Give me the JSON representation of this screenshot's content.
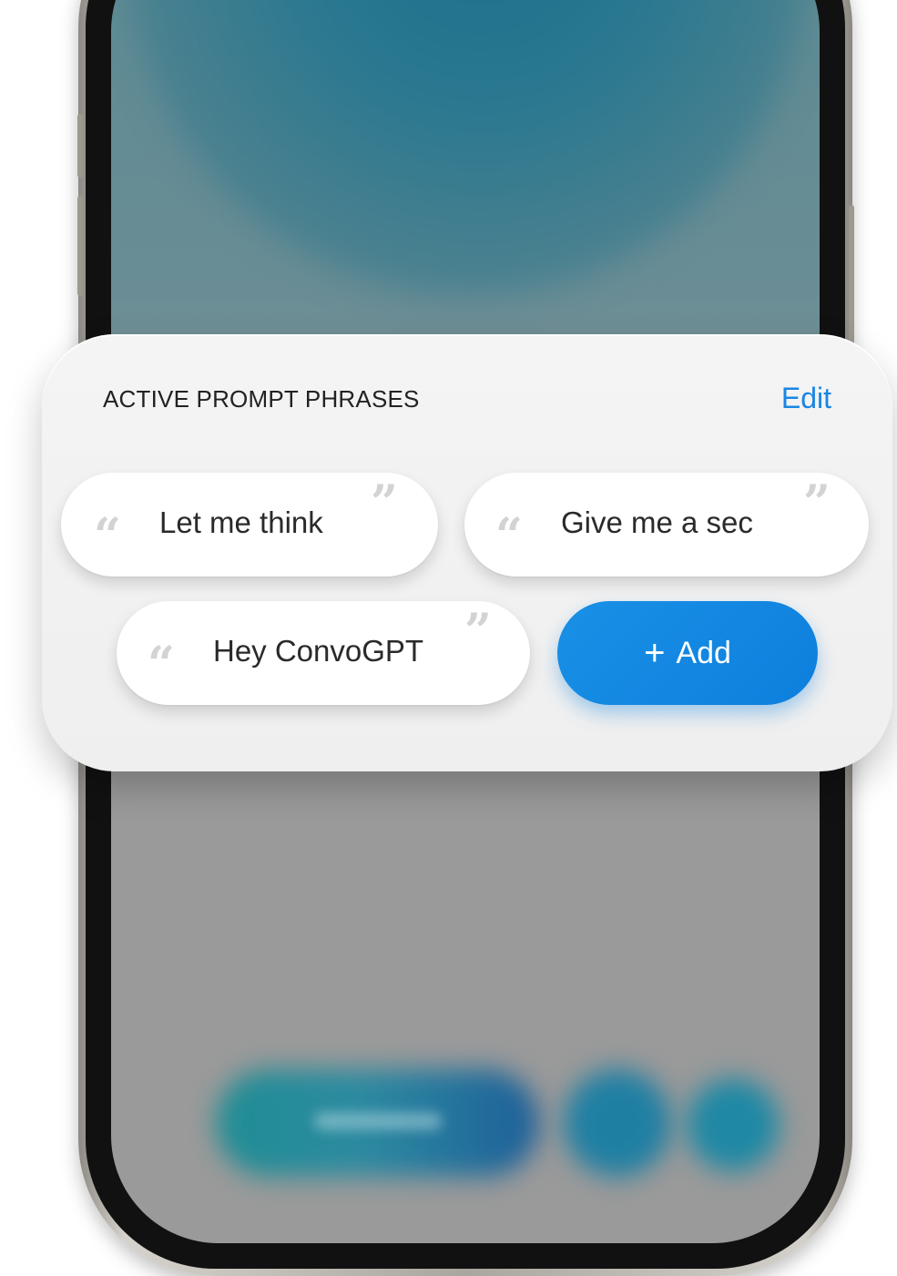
{
  "prompt_phrases": {
    "title": "ACTIVE PROMPT PHRASES",
    "edit_label": "Edit",
    "phrases": [
      {
        "label": "Let me think"
      },
      {
        "label": "Give me a sec"
      },
      {
        "label": "Hey ConvoGPT"
      }
    ],
    "add_button": {
      "icon": "plus-icon",
      "label": "Add",
      "plus_glyph": "+"
    },
    "quote_open_glyph": "“",
    "quote_close_glyph": "”"
  },
  "colors": {
    "accent": "#1a86e3",
    "add_button_bg": "#0d7fdd",
    "card_bg": "#f1f1f1",
    "chip_bg": "#ffffff",
    "quote_color": "#d3d3d3"
  }
}
